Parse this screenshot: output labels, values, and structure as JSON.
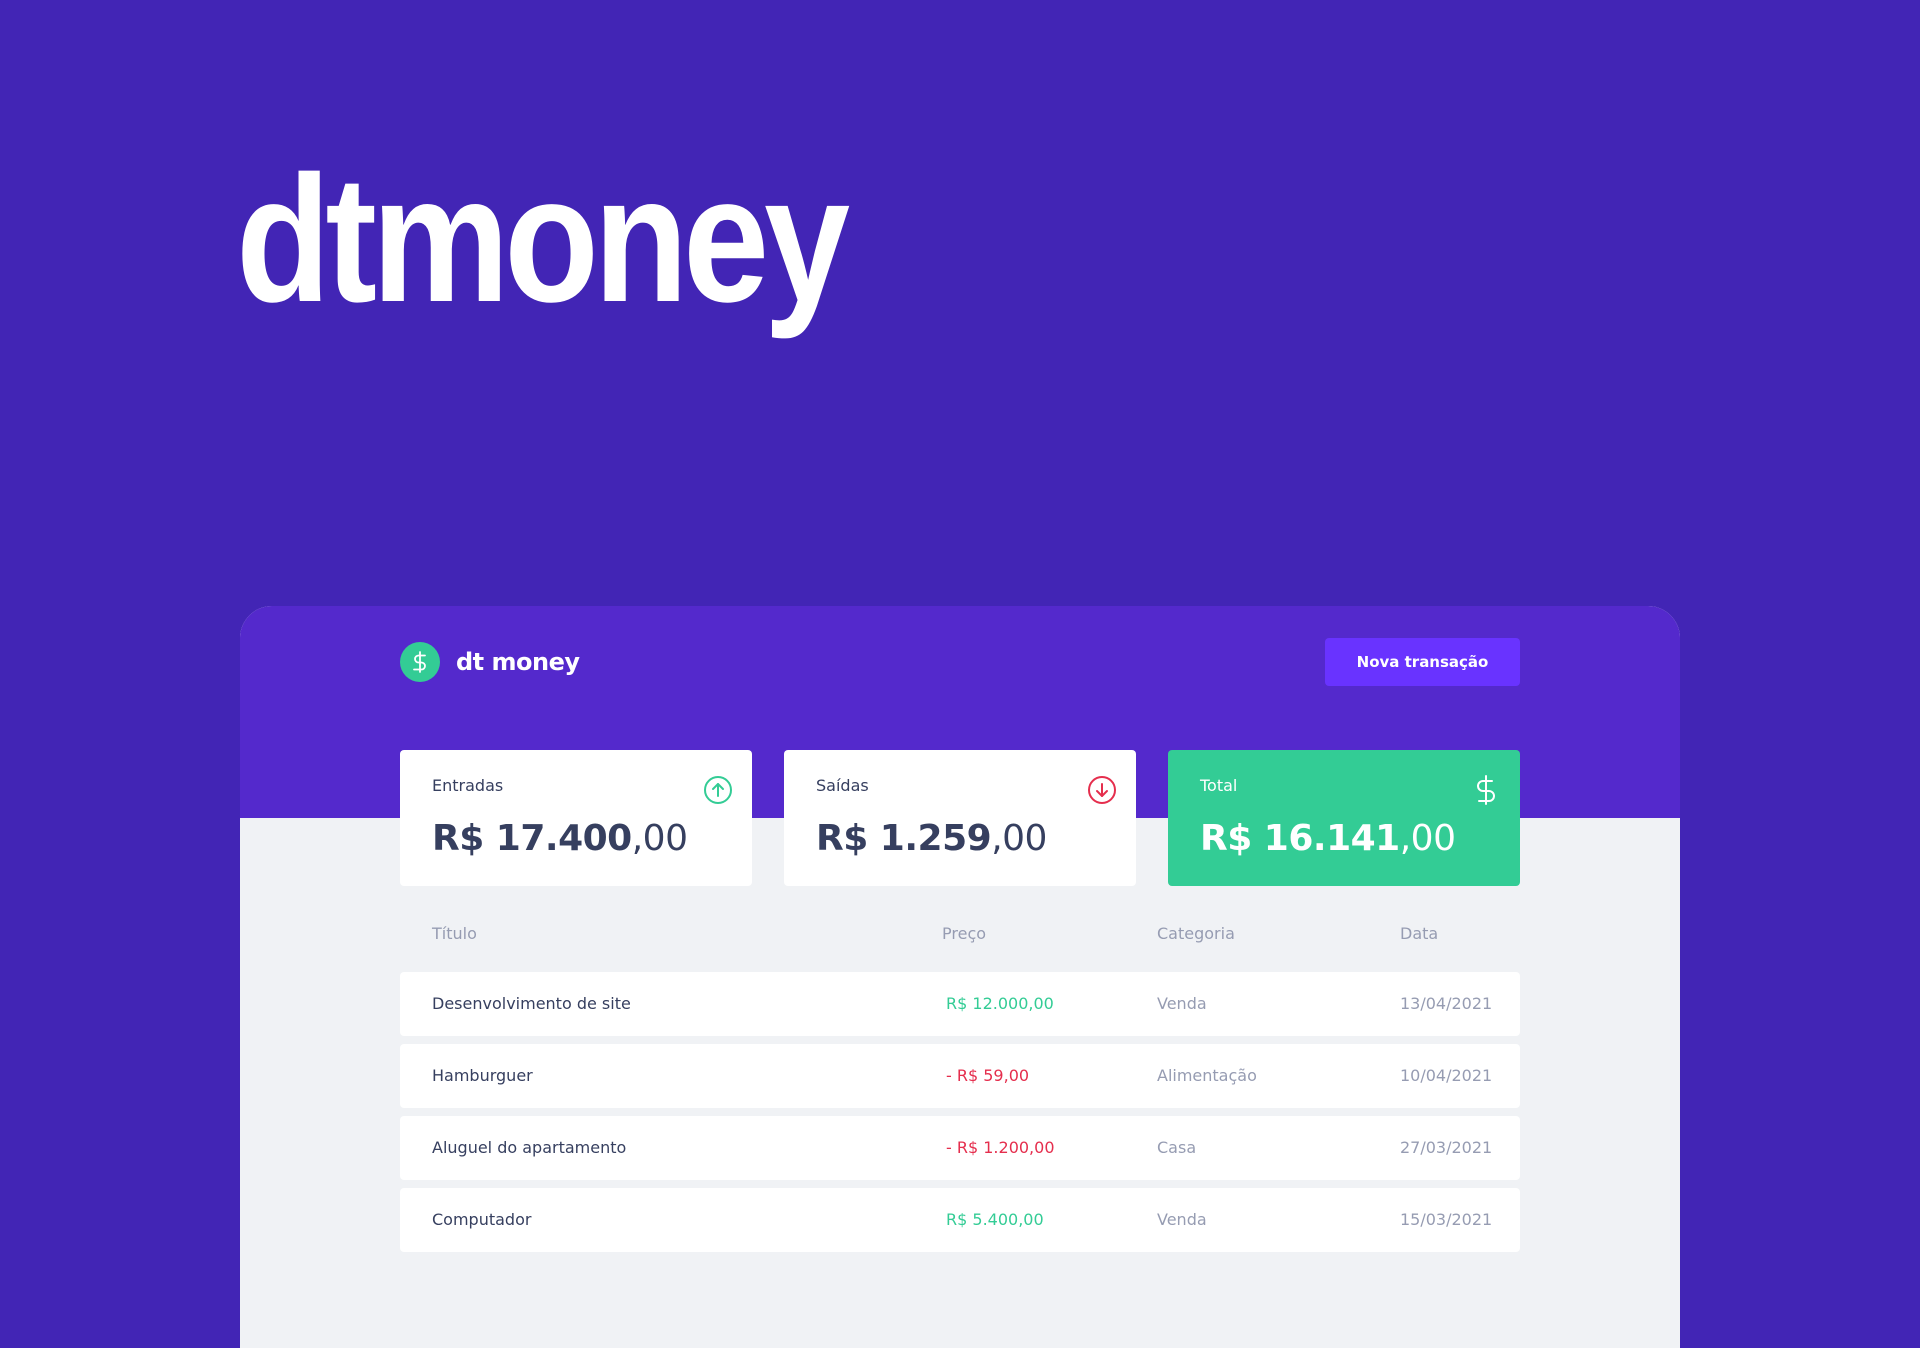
{
  "hero": {
    "title": "dtmoney"
  },
  "app": {
    "brand_name": "dt money",
    "new_transaction_label": "Nova transação"
  },
  "summary": {
    "income": {
      "label": "Entradas",
      "amount_main": "R$ 17.400",
      "amount_cents": ",00",
      "icon": "arrow-up-circle-icon",
      "color": "#33CC95"
    },
    "outcome": {
      "label": "Saídas",
      "amount_main": "R$ 1.259",
      "amount_cents": ",00",
      "icon": "arrow-down-circle-icon",
      "color": "#E52E4D"
    },
    "total": {
      "label": "Total",
      "amount_main": "R$ 16.141",
      "amount_cents": ",00",
      "icon": "dollar-icon",
      "color": "#33CC95"
    }
  },
  "table": {
    "headers": {
      "title": "Título",
      "price": "Preço",
      "category": "Categoria",
      "date": "Data"
    },
    "rows": [
      {
        "title": "Desenvolvimento de site",
        "price": "R$ 12.000,00",
        "category": "Venda",
        "date": "13/04/2021",
        "type": "income"
      },
      {
        "title": "Hamburguer",
        "price": "- R$ 59,00",
        "category": "Alimentação",
        "date": "10/04/2021",
        "type": "outcome"
      },
      {
        "title": "Aluguel do apartamento",
        "price": "- R$ 1.200,00",
        "category": "Casa",
        "date": "27/03/2021",
        "type": "outcome"
      },
      {
        "title": "Computador",
        "price": "R$ 5.400,00",
        "category": "Venda",
        "date": "15/03/2021",
        "type": "income"
      }
    ]
  },
  "colors": {
    "background": "#4225B5",
    "header": "#5429CC",
    "button": "#6933FF",
    "green": "#33CC95",
    "red": "#E52E4D",
    "text": "#363F5F",
    "muted": "#969CB2",
    "surface": "#F0F2F5"
  }
}
